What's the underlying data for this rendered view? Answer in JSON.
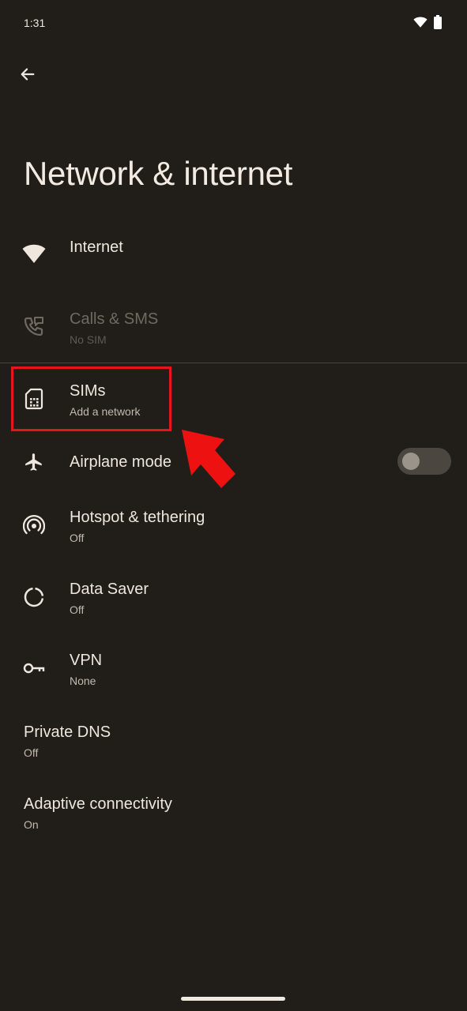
{
  "status_bar": {
    "time": "1:31"
  },
  "header": {
    "back_icon": "arrow-left-icon",
    "title": "Network & internet"
  },
  "items": [
    {
      "title": "Internet",
      "subtitle": "",
      "icon": "wifi-icon"
    },
    {
      "title": "Calls & SMS",
      "subtitle": "No SIM",
      "icon": "phone-sms-icon",
      "disabled": true
    },
    {
      "title": "SIMs",
      "subtitle": "Add a network",
      "icon": "sim-card-icon"
    },
    {
      "title": "Airplane mode",
      "subtitle": "",
      "icon": "airplane-icon",
      "toggle": "off"
    },
    {
      "title": "Hotspot & tethering",
      "subtitle": "Off",
      "icon": "hotspot-icon"
    },
    {
      "title": "Data Saver",
      "subtitle": "Off",
      "icon": "data-saver-icon"
    },
    {
      "title": "VPN",
      "subtitle": "None",
      "icon": "key-icon"
    },
    {
      "title": "Private DNS",
      "subtitle": "Off"
    },
    {
      "title": "Adaptive connectivity",
      "subtitle": "On"
    }
  ],
  "colors": {
    "background": "#211e1a",
    "text": "#efe7de",
    "subtext": "#c2b9ae",
    "annotation": "#e8141c"
  }
}
